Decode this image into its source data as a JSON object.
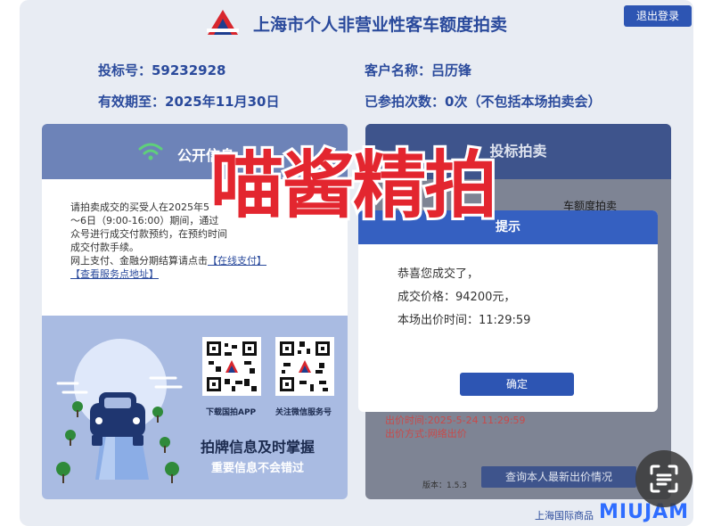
{
  "header": {
    "title": "上海市个人非营业性客车额度拍卖",
    "logout_label": "退出登录"
  },
  "info": {
    "bid_no": "投标号：59232928",
    "customer_name": "客户名称：吕历锋",
    "valid_until": "有效期至：2025年11月30日",
    "attempts": "已参拍次数：0次（不包括本场拍卖会）"
  },
  "public_info": {
    "title": "公开信息",
    "notice_lines": [
      "请拍卖成交的买受人在2025年5",
      "～6日（9:00-16:00）期间，通过",
      "众号进行成交付款预约，在预约时间",
      "成交付款手续。"
    ],
    "payment_prefix": "网上支付、金融分期结算请点击",
    "online_pay_link": "【在线支付】",
    "service_point_link": "【查看服务点地址】",
    "qr_left_label": "下载国拍APP",
    "qr_right_label": "关注微信服务号",
    "slogan_main": "拍牌信息及时掌握",
    "slogan_sub": "重要信息不会错过"
  },
  "bidding": {
    "title": "投标拍卖",
    "background_line": "车额度拍卖",
    "bid_time": "出价时间:2025-5-24 11:29:59",
    "bid_method": "出价方式:网络出价",
    "version": "版本：1.5.3",
    "query_button": "查询本人最新出价情况"
  },
  "dialog": {
    "title": "提示",
    "line1": "恭喜您成交了，",
    "line2": "成交价格：94200元，",
    "line3": "本场出价时间：11:29:59",
    "confirm_label": "确定"
  },
  "overlay": {
    "watermark": "喵酱精拍",
    "footer_text": "上海国际商品",
    "brand": "MIUJAM"
  },
  "colors": {
    "primary": "#2d55b3",
    "title_blue": "#2a4a9c",
    "watermark_red": "#e3262f"
  }
}
